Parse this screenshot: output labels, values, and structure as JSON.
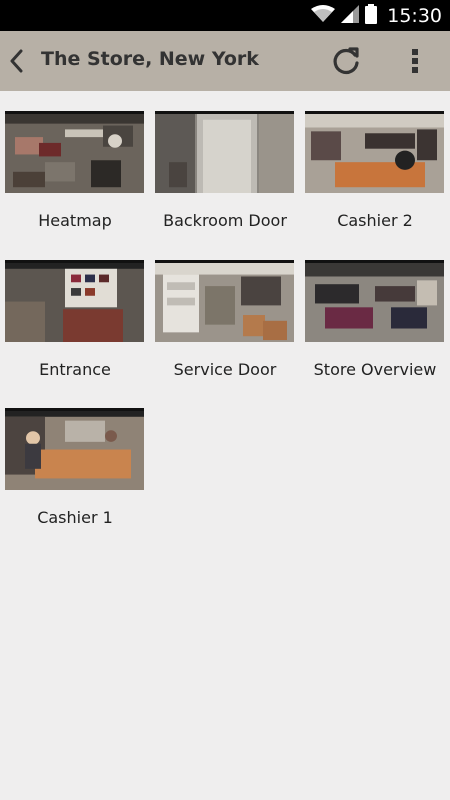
{
  "status_bar": {
    "time": "15:30",
    "icons": [
      "wifi-icon",
      "signal-icon",
      "battery-icon"
    ]
  },
  "toolbar": {
    "title": "The Store, New York",
    "back_icon": "back-arrow-icon",
    "refresh_icon": "refresh-icon",
    "menu_icon": "overflow-menu-icon"
  },
  "cameras": [
    {
      "name": "Heatmap"
    },
    {
      "name": "Backroom Door"
    },
    {
      "name": "Cashier 2"
    },
    {
      "name": "Entrance"
    },
    {
      "name": "Service Door"
    },
    {
      "name": "Store Overview"
    },
    {
      "name": "Cashier 1"
    }
  ],
  "colors": {
    "toolbar_bg": "#b7b0a6",
    "page_bg": "#efeeee",
    "status_bar_bg": "#000000"
  }
}
